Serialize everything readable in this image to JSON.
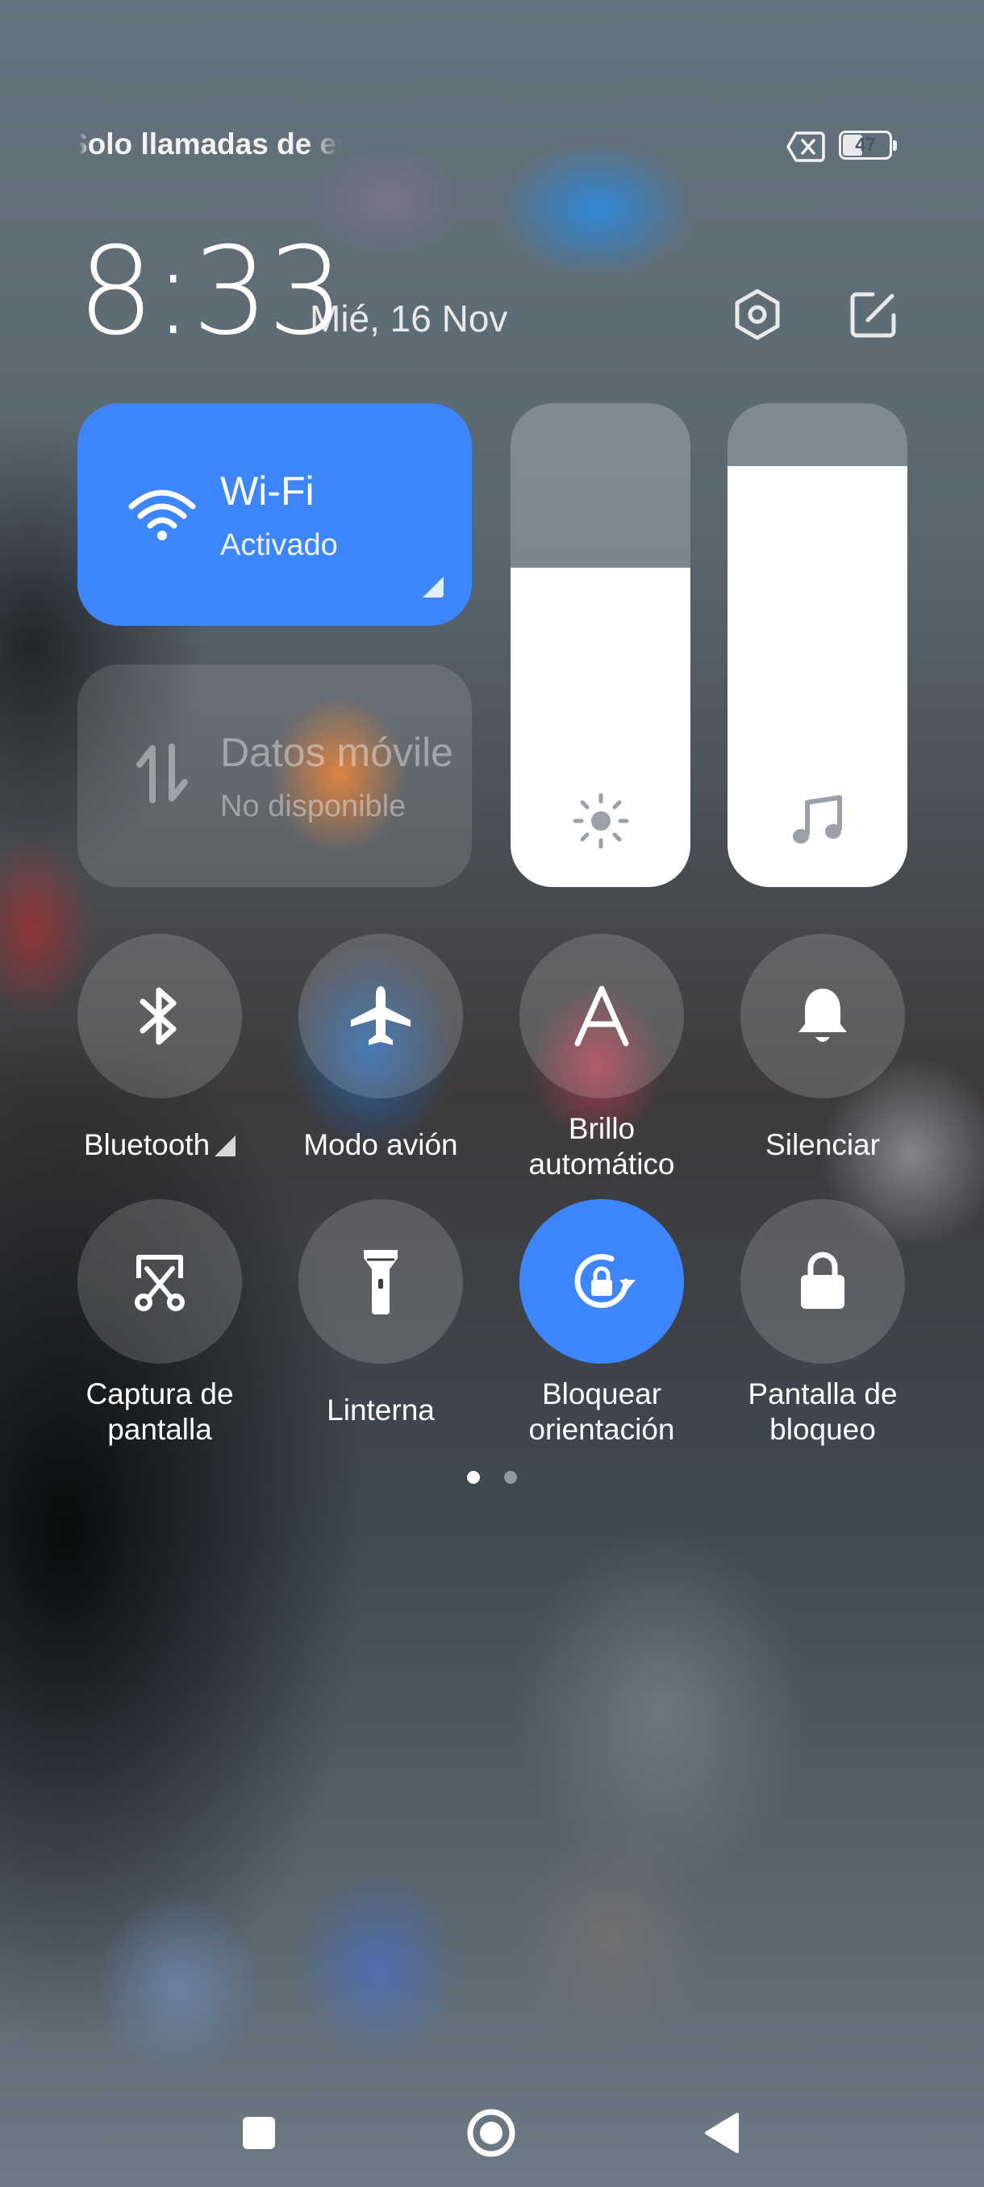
{
  "status_bar": {
    "carrier_text": "Solo llamadas de emergencia",
    "sim_icon": "sim-missing-icon",
    "battery_level": "47",
    "battery_fraction": 0.47
  },
  "header": {
    "time": "8:33",
    "date": "Mié, 16 Nov",
    "settings_icon": "gear-icon",
    "edit_icon": "edit-icon"
  },
  "tiles": {
    "wifi": {
      "title": "Wi-Fi",
      "subtitle": "Activado",
      "icon": "wifi-icon",
      "active": true
    },
    "mobile_data": {
      "title": "Datos móviles",
      "subtitle": "No disponible",
      "icon": "mobile-data-icon",
      "active": false
    }
  },
  "sliders": {
    "brightness": {
      "icon": "sun-icon",
      "level": 0.66
    },
    "volume": {
      "icon": "music-note-icon",
      "level": 0.87
    }
  },
  "toggles": [
    {
      "label": "Bluetooth",
      "icon": "bluetooth-icon",
      "active": false
    },
    {
      "label": "Modo avión",
      "icon": "airplane-icon",
      "active": false
    },
    {
      "label": "Brillo\nautomático",
      "icon": "auto-brightness-icon",
      "active": false
    },
    {
      "label": "Silenciar",
      "icon": "bell-icon",
      "active": false
    },
    {
      "label": "Captura de\npantalla",
      "icon": "screenshot-icon",
      "active": false
    },
    {
      "label": "Linterna",
      "icon": "flashlight-icon",
      "active": false
    },
    {
      "label": "Bloquear\norientación",
      "icon": "rotation-lock-icon",
      "active": true
    },
    {
      "label": "Pantalla de\nbloqueo",
      "icon": "lock-icon",
      "active": false
    }
  ],
  "toggle_labels": {
    "bluetooth": "Bluetooth",
    "airplane": "Modo avión",
    "auto_brightness_1": "Brillo",
    "auto_brightness_2": "automático",
    "mute": "Silenciar",
    "screenshot_1": "Captura de",
    "screenshot_2": "pantalla",
    "flashlight": "Linterna",
    "rotation_1": "Bloquear",
    "rotation_2": "orientación",
    "lockscreen_1": "Pantalla de",
    "lockscreen_2": "bloqueo"
  },
  "page_indicator": {
    "pages": 2,
    "current": 1
  },
  "nav_bar": {
    "recents_icon": "square-icon",
    "home_icon": "circle-icon",
    "back_icon": "triangle-back-icon"
  },
  "colors": {
    "accent": "#3d86ff",
    "inactive_tile": "rgba(255,255,255,0.16)",
    "text": "#ffffff"
  }
}
